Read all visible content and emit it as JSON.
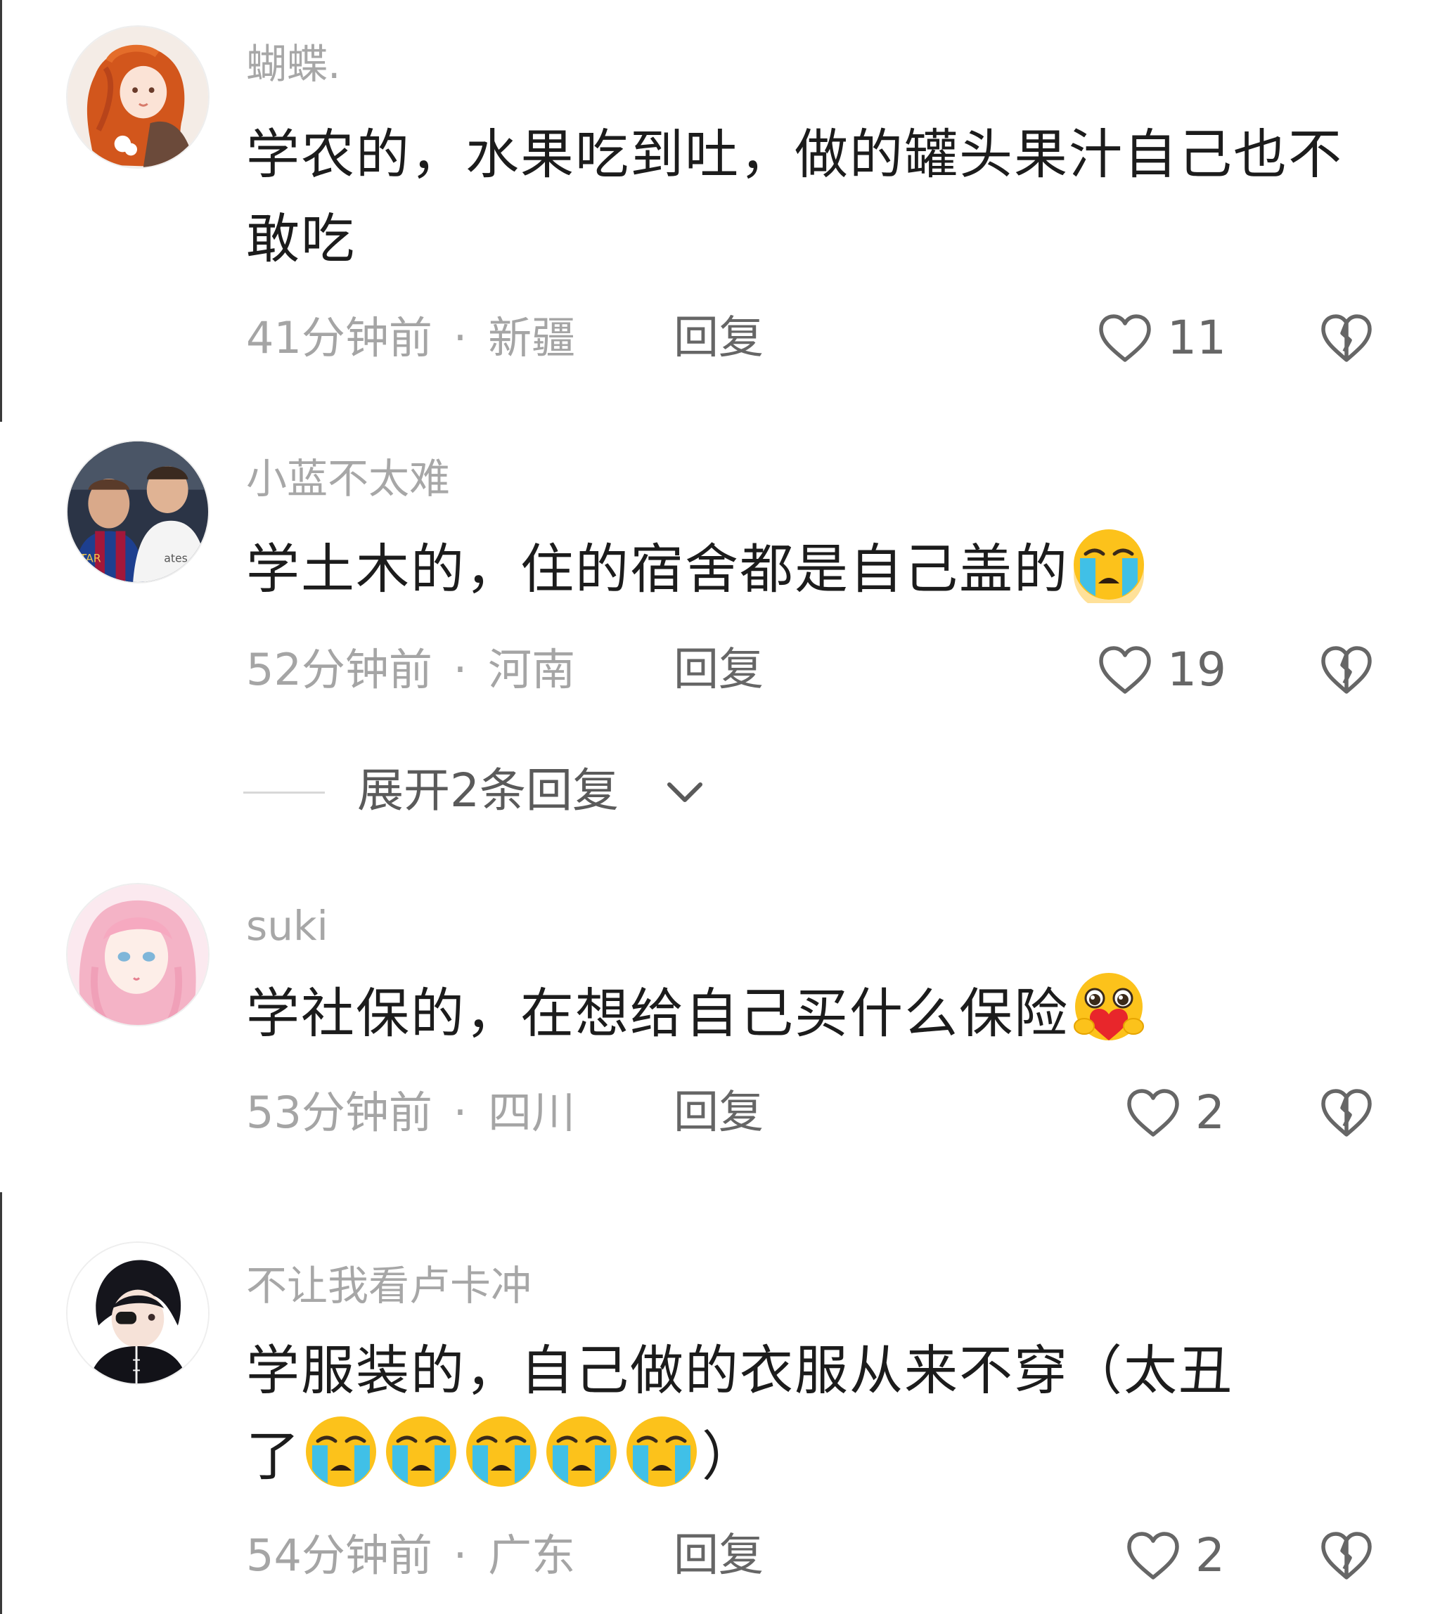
{
  "comments": [
    {
      "username": "蝴蝶.",
      "content": "学农的，水果吃到吐，做的罐头果汁自己也不敢吃",
      "emojis": [],
      "time": "41分钟前",
      "location": "新疆",
      "reply_label": "回复",
      "likes": "11",
      "avatar_icon": "avatar-red-hair-girl"
    },
    {
      "username": "小蓝不太难",
      "content": "学土木的，住的宿舍都是自己盖的",
      "emojis": [
        "crying-face"
      ],
      "time": "52分钟前",
      "location": "河南",
      "reply_label": "回复",
      "likes": "19",
      "avatar_icon": "avatar-football-players",
      "expand_label": "展开2条回复"
    },
    {
      "username": "suki",
      "content": "学社保的，在想给自己买什么保险",
      "emojis": [
        "face-holding-heart"
      ],
      "time": "53分钟前",
      "location": "四川",
      "reply_label": "回复",
      "likes": "2",
      "avatar_icon": "avatar-pink-hair-girl"
    },
    {
      "username": "不让我看卢卡冲",
      "content_main": "学服装的，自己做的衣服从来不穿（太丑",
      "content_tail_pre": "了",
      "content_tail_post": "）",
      "emojis": [
        "crying-face",
        "crying-face",
        "crying-face",
        "crying-face",
        "crying-face"
      ],
      "time": "54分钟前",
      "location": "广东",
      "reply_label": "回复",
      "likes": "2",
      "avatar_icon": "avatar-dark-hair-boy"
    }
  ],
  "separator": "·",
  "colors": {
    "username": "#a7a7a7",
    "content": "#1c1c1c",
    "meta": "#a5a5a5",
    "reply": "#666666"
  }
}
